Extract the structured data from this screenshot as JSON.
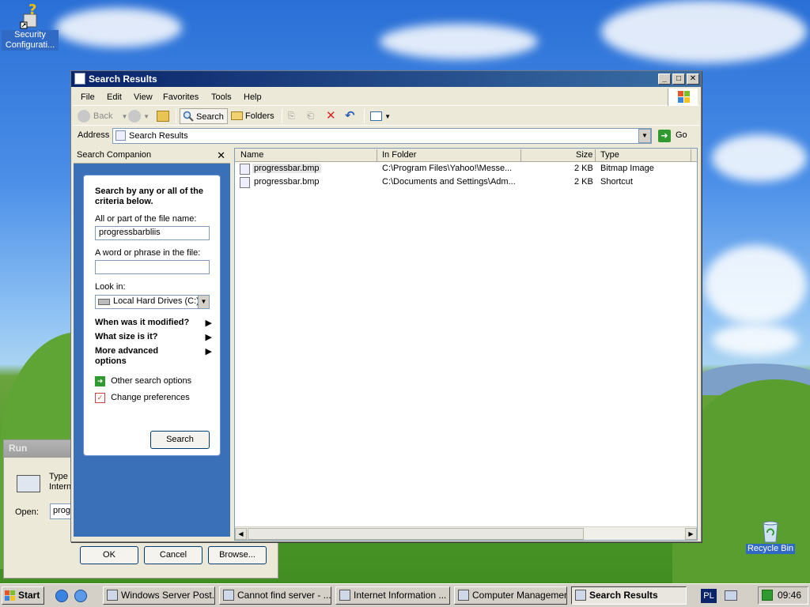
{
  "desktop": {
    "icons": [
      {
        "label": "Security Configurati...",
        "icon": "security-config-icon"
      },
      {
        "label": "Recycle Bin",
        "icon": "recycle-bin-icon"
      }
    ]
  },
  "run_dialog": {
    "title": "Run",
    "type_text_1": "Type",
    "type_text_2": "Intern",
    "open_label": "Open:",
    "open_value": "prog",
    "ok_label": "OK",
    "cancel_label": "Cancel",
    "browse_label": "Browse..."
  },
  "window": {
    "title": "Search Results",
    "menu": [
      "File",
      "Edit",
      "View",
      "Favorites",
      "Tools",
      "Help"
    ],
    "toolbar": {
      "back": "Back",
      "search": "Search",
      "folders": "Folders"
    },
    "address": {
      "label": "Address",
      "value": "Search Results",
      "go": "Go"
    },
    "search_pane": {
      "title": "Search Companion",
      "heading": "Search by any or all of the criteria below.",
      "file_name_label": "All or part of the file name:",
      "file_name_value": "progressbarbliis",
      "phrase_label": "A word or phrase in the file:",
      "phrase_value": "",
      "look_in_label": "Look in:",
      "look_in_value": "Local Hard Drives (C:)",
      "modified": "When was it modified?",
      "size": "What size is it?",
      "advanced": "More advanced options",
      "other_options": "Other search options",
      "change_prefs": "Change preferences",
      "search_button": "Search"
    },
    "results": {
      "columns": [
        "Name",
        "In Folder",
        "Size",
        "Type"
      ],
      "rows": [
        {
          "name": "progressbar.bmp",
          "folder": "C:\\Program Files\\Yahoo!\\Messe...",
          "size": "2 KB",
          "type": "Bitmap Image"
        },
        {
          "name": "progressbar.bmp",
          "folder": "C:\\Documents and Settings\\Adm...",
          "size": "2 KB",
          "type": "Shortcut"
        }
      ]
    }
  },
  "taskbar": {
    "start": "Start",
    "tasks": [
      "Windows Server Post...",
      "Cannot find server - ...",
      "Internet Information ...",
      "Computer Management",
      "Search Results"
    ],
    "language": "PL",
    "clock": "09:46"
  }
}
